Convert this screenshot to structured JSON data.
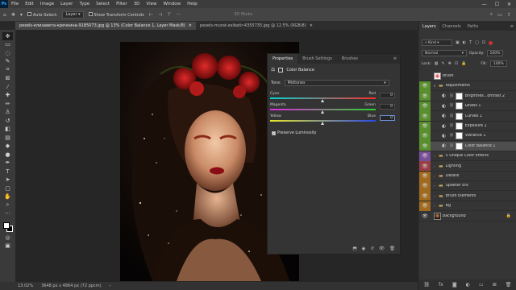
{
  "menubar": {
    "logo": "Ps",
    "items": [
      "File",
      "Edit",
      "Image",
      "Layer",
      "Type",
      "Select",
      "Filter",
      "3D",
      "View",
      "Window",
      "Help"
    ],
    "controls": [
      "—",
      "☐",
      "✕"
    ]
  },
  "options": {
    "auto_select": "Auto-Select:",
    "layer_value": "Layer",
    "show_transform": "Show Transform Controls",
    "mode_3d": "3D Mode:"
  },
  "tabs": [
    {
      "label": "pexels-елизавета-кречкина-9185073.jpg @ 13% (Color Balance 1, Layer Mask/8)",
      "active": true
    },
    {
      "label": "pexels-murat-esibatir-4355735.jpg @ 12.5% (RGB/8)",
      "active": false
    }
  ],
  "status": {
    "zoom": "13.02%",
    "doc_size": "3648 px x 4864 px (72 ppcm)"
  },
  "properties": {
    "tabs": [
      "Properties",
      "Brush Settings",
      "Brushes"
    ],
    "title": "Color Balance",
    "tone_label": "Tone:",
    "tone_value": "Midtones",
    "sliders": [
      {
        "left": "Cyan",
        "right": "Red",
        "value": "0",
        "position": 0.5
      },
      {
        "left": "Magenta",
        "right": "Green",
        "value": "0",
        "position": 0.5
      },
      {
        "left": "Yellow",
        "right": "Blue",
        "value": "0",
        "position": 0.5
      }
    ],
    "preserve_luminosity": "Preserve Luminosity"
  },
  "layers": {
    "tabs": [
      "Layers",
      "Channels",
      "Paths"
    ],
    "kind": "Kind",
    "blend_mode": "Normal",
    "opacity_label": "Opacity:",
    "opacity_value": "100%",
    "lock_label": "Lock:",
    "fill_label": "Fill:",
    "fill_value": "100%",
    "rows": [
      {
        "name": "brush",
        "type": "thumb-red",
        "eye": "",
        "color": ""
      },
      {
        "name": "Adjustments",
        "type": "folder",
        "eye": "👁",
        "color": "#5a8f2f",
        "open": true
      },
      {
        "name": "Brightnes...ontrast 2",
        "type": "adj",
        "eye": "👁",
        "color": "#5a8f2f"
      },
      {
        "name": "Levels 1",
        "type": "adj",
        "eye": "👁",
        "color": "#5a8f2f"
      },
      {
        "name": "Curves 1",
        "type": "adj",
        "eye": "👁",
        "color": "#5a8f2f"
      },
      {
        "name": "Exposure 1",
        "type": "adj",
        "eye": "👁",
        "color": "#5a8f2f"
      },
      {
        "name": "Vibrance 1",
        "type": "adj",
        "eye": "👁",
        "color": "#5a8f2f"
      },
      {
        "name": "Color Balance 1",
        "type": "adj-selected",
        "eye": "👁",
        "color": "#5a8f2f"
      },
      {
        "name": "5 Unique Color Effects",
        "type": "folder",
        "eye": "👁",
        "color": "#7a4f9a"
      },
      {
        "name": "Lighting",
        "type": "folder",
        "eye": "👁",
        "color": "#9a3f45"
      },
      {
        "name": "Details",
        "type": "folder",
        "eye": "👁",
        "color": "#a06a1f"
      },
      {
        "name": "Splatter Efx",
        "type": "folder",
        "eye": "👁",
        "color": "#a06a1f"
      },
      {
        "name": "Brush Elements",
        "type": "folder",
        "eye": "👁",
        "color": "#a06a1f"
      },
      {
        "name": "Bg",
        "type": "folder",
        "eye": "👁",
        "color": "#a06a1f"
      },
      {
        "name": "Background",
        "type": "bg",
        "eye": "👁",
        "color": ""
      }
    ]
  }
}
